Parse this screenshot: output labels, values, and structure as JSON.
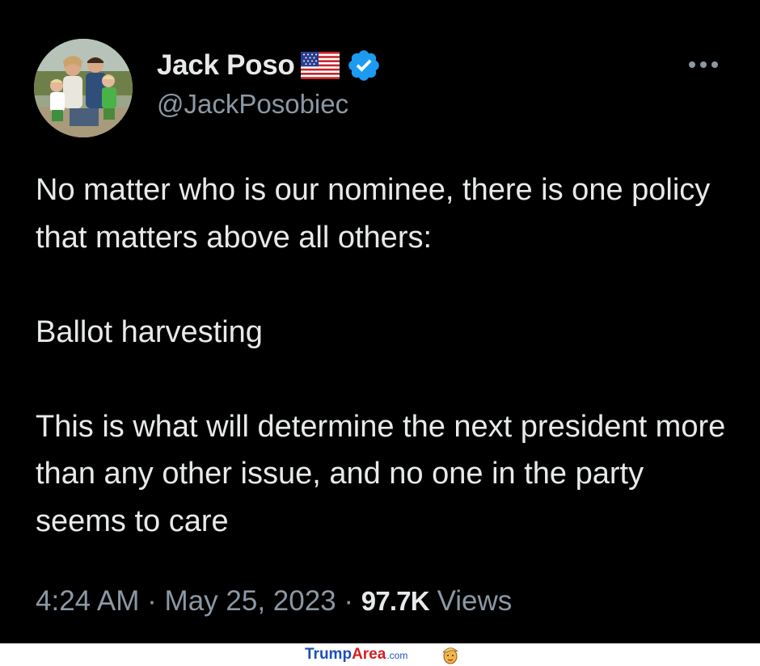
{
  "author": {
    "display_name": "Jack Poso",
    "handle": "@JackPosobiec",
    "flag_icon": "us-flag-icon",
    "verified_icon": "verified-badge-icon",
    "verified_color": "#1d9bf0"
  },
  "tweet": {
    "paragraphs": [
      "No matter who is our nominee, there is one policy that matters above all others:",
      "Ballot harvesting",
      "This is what will determine the next president more than any other issue, and no one in the party seems to care"
    ]
  },
  "meta": {
    "time": "4:24 AM",
    "separator": "·",
    "date": "May 25, 2023",
    "views_count": "97.7K",
    "views_label": "Views"
  },
  "watermark": {
    "brand_part1": "Trump",
    "brand_part2": "Area",
    "brand_suffix": ".com",
    "logo_icon": "trump-face-icon"
  },
  "colors": {
    "background": "#000000",
    "text_primary": "#e7e9ea",
    "text_secondary": "#8b98a5"
  }
}
